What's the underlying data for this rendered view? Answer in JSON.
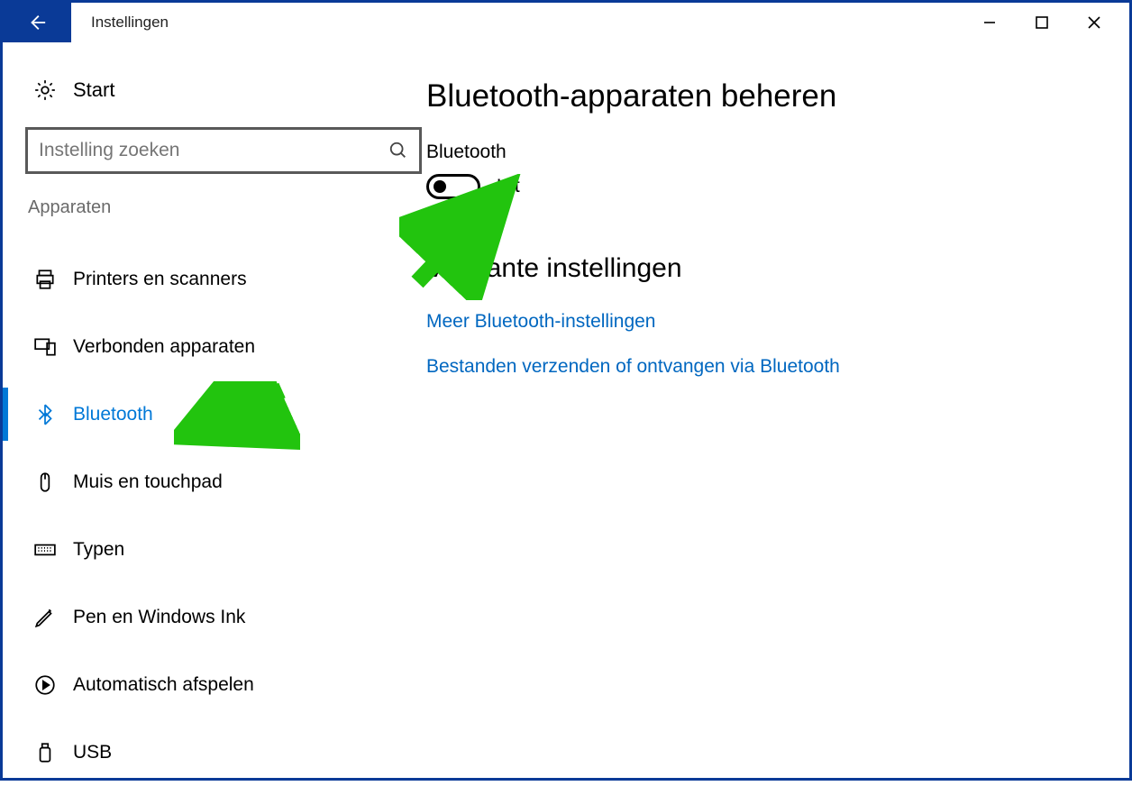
{
  "titlebar": {
    "title": "Instellingen"
  },
  "sidebar": {
    "start_label": "Start",
    "search_placeholder": "Instelling zoeken",
    "group_header": "Apparaten",
    "items": [
      {
        "key": "printers",
        "label": "Printers en scanners"
      },
      {
        "key": "connected-devices",
        "label": "Verbonden apparaten"
      },
      {
        "key": "bluetooth",
        "label": "Bluetooth"
      },
      {
        "key": "mouse",
        "label": "Muis en touchpad"
      },
      {
        "key": "typing",
        "label": "Typen"
      },
      {
        "key": "pen",
        "label": "Pen en Windows Ink"
      },
      {
        "key": "autoplay",
        "label": "Automatisch afspelen"
      },
      {
        "key": "usb",
        "label": "USB"
      }
    ],
    "active_index": 2
  },
  "main": {
    "heading": "Bluetooth-apparaten beheren",
    "bluetooth_label": "Bluetooth",
    "toggle_state": false,
    "toggle_state_label": "Uit",
    "related_heading": "Verwante instellingen",
    "links": [
      "Meer Bluetooth-instellingen",
      "Bestanden verzenden of ontvangen via Bluetooth"
    ]
  },
  "colors": {
    "accent": "#0a3a97",
    "link": "#0067c0",
    "active": "#0078d7",
    "annotation": "#22c40e"
  }
}
